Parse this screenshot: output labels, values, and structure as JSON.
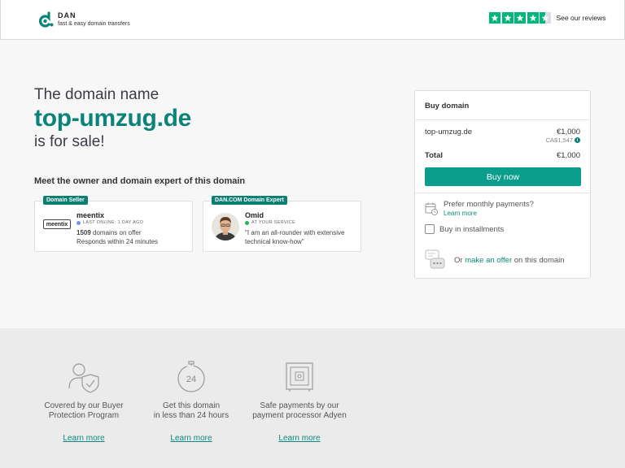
{
  "header": {
    "logo_name": "DAN",
    "logo_tagline": "fast & easy domain transfers",
    "reviews_label": "See our reviews",
    "brand_color": "#0b8378",
    "trustpilot_color": "#00b67a",
    "trustpilot_rating_stars": 4.5
  },
  "hero": {
    "line1": "The domain name",
    "domain": "top-umzug.de",
    "line3": "is for sale!"
  },
  "meet": {
    "heading": "Meet the owner and domain expert of this domain",
    "seller": {
      "badge": "Domain Seller",
      "logo_text": "meentix",
      "name": "meentix",
      "status": "LAST ONLINE: 1 DAY AGO",
      "status_color": "#7b8cf0",
      "count": "1509",
      "count_suffix": "domains on offer",
      "response": "Responds within 24 minutes"
    },
    "expert": {
      "badge": "DAN.COM Domain Expert",
      "name": "Omid",
      "status": "AT YOUR SERVICE",
      "status_color": "#22b35e",
      "quote_line1": "\"I am an all-rounder with extensive",
      "quote_line2": "technical know-how\""
    }
  },
  "buybox": {
    "title": "Buy domain",
    "domain": "top-umzug.de",
    "price": "€1,000",
    "price_cad": "CA$1,547",
    "total_label": "Total",
    "total_value": "€1,000",
    "buy_button": "Buy now",
    "monthly_question": "Prefer monthly payments?",
    "learn_more": "Learn more",
    "installments": "Buy in installments",
    "offer_prefix": "Or",
    "offer_link": "make an offer",
    "offer_suffix": "on this domain"
  },
  "footer": {
    "features": [
      {
        "icon": "shield-person-icon",
        "line1": "Covered by our Buyer",
        "line2": "Protection Program",
        "link": "Learn more"
      },
      {
        "icon": "stopwatch-24-icon",
        "line1": "Get this domain",
        "line2": "in less than 24 hours",
        "link": "Learn more"
      },
      {
        "icon": "safe-icon",
        "line1": "Safe payments by our",
        "line2": "payment processor Adyen",
        "link": "Learn more"
      }
    ]
  }
}
